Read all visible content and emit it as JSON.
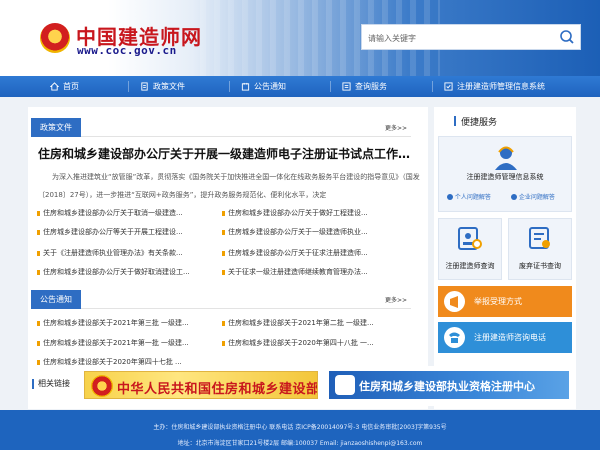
{
  "header": {
    "site_title": "中国建造师网",
    "site_url": "www.coc.gov.cn",
    "search_placeholder": "请输入关键字"
  },
  "nav": {
    "items": [
      {
        "label": "首页",
        "icon": "home-icon"
      },
      {
        "label": "政策文件",
        "icon": "document-icon"
      },
      {
        "label": "公告通知",
        "icon": "notice-icon"
      },
      {
        "label": "查询服务",
        "icon": "search-service-icon"
      },
      {
        "label": "注册建造师管理信息系统",
        "icon": "system-icon"
      }
    ]
  },
  "policy": {
    "tab_label": "政策文件",
    "more": "更多>>",
    "headline": "住房和城乡建设部办公厅关于开展一级建造师电子注册证书试点工作的...",
    "summary": "为深入推进建筑业“放管服”改革，贯彻落实《国务院关于加快推进全国一体化在线政务服务平台建设的指导意见》（国发〔2018〕27号），进一步推进“互联网+政务服务”，提升政务服务规范化、便利化水平，决定",
    "items_left": [
      "住房和城乡建设部办公厅关于取消一级建造...",
      "住房城乡建设部办公厅等关于开展工程建设...",
      "关于《注册建造师执业管理办法》有关条款...",
      "住房和城乡建设部办公厅关于做好取消建设工..."
    ],
    "items_right": [
      "住房和城乡建设部办公厅关于做好工程建设...",
      "住房城乡建设部办公厅关于一级建造师执业...",
      "住房城乡建设部办公厅关于征求注册建造师...",
      "关于征求一级注册建造师继续教育管理办法..."
    ]
  },
  "notice": {
    "tab_label": "公告通知",
    "more": "更多>>",
    "items_left": [
      "住房和城乡建设部关于2021年第三批 一级建...",
      "住房和城乡建设部关于2021年第一批 一级建...",
      "住房和城乡建设部关于2020年第四十七批 ..."
    ],
    "items_right": [
      "住房和城乡建设部关于2021年第二批 一级建...",
      "住房和城乡建设部关于2020年第四十八批 一..."
    ]
  },
  "sidebar": {
    "title": "便捷服务",
    "system_card": {
      "label": "注册建造师管理信息系统",
      "pill1": "个人问题解答",
      "pill2": "企业问题解答"
    },
    "query_card": {
      "label": "注册建造师查询"
    },
    "revoke_card": {
      "label": "废弃证书查询"
    },
    "report_button": {
      "label": "举报受理方式"
    },
    "phone_button": {
      "label": "注册建造师咨询电话"
    },
    "colors": {
      "report": "#f08a1c",
      "phone": "#2e8fd8"
    }
  },
  "links": {
    "label": "相关链接",
    "banner1": "中华人民共和国住房和城乡建设部",
    "banner2": "住房和城乡建设部执业资格注册中心"
  },
  "footer": {
    "line1": "主办：住房和城乡建设部执业资格注册中心 联系电话 京ICP备20014097号-3 电信业务审批[2003]字第935号",
    "line2": "地址：北京市海淀区甘家口21号楼2层 邮编:100037 Email: jianzaoshishenpi@163.com"
  }
}
